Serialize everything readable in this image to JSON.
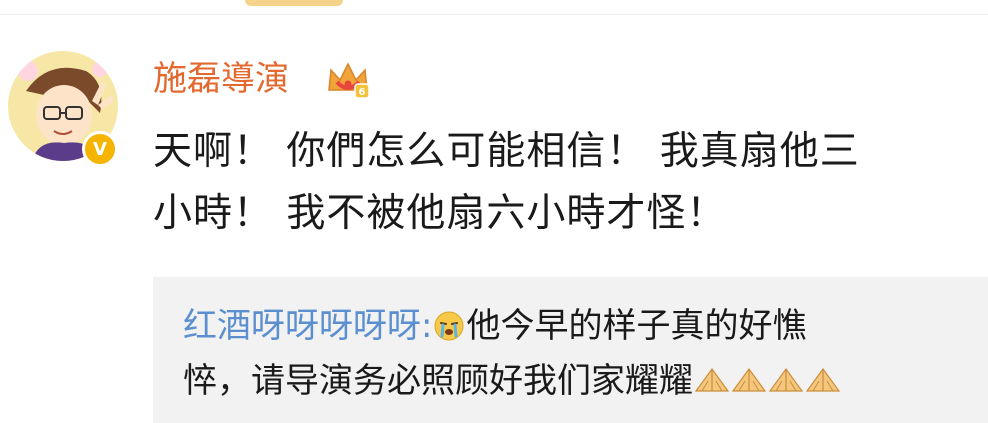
{
  "comment": {
    "author": "施磊導演",
    "author_color": "#e3692e",
    "member_badge_icon": "vip-crown-icon",
    "verified_badge_label": "V",
    "text_line1": "天啊！ 你們怎么可能相信！  我真扇他三",
    "text_line2": "小時！ 我不被他扇六小時才怪！"
  },
  "reply": {
    "user": "红酒呀呀呀呀呀:",
    "user_color": "#5b8fd0",
    "emoji_1": "crying-emoji",
    "text_part1": "他今早的样子真的好憔",
    "text_part2": "悴，请导演务必照顾好我们家耀耀",
    "emoji_trailing": [
      "praying-hands-emoji",
      "praying-hands-emoji",
      "praying-hands-emoji",
      "praying-hands-emoji"
    ]
  }
}
